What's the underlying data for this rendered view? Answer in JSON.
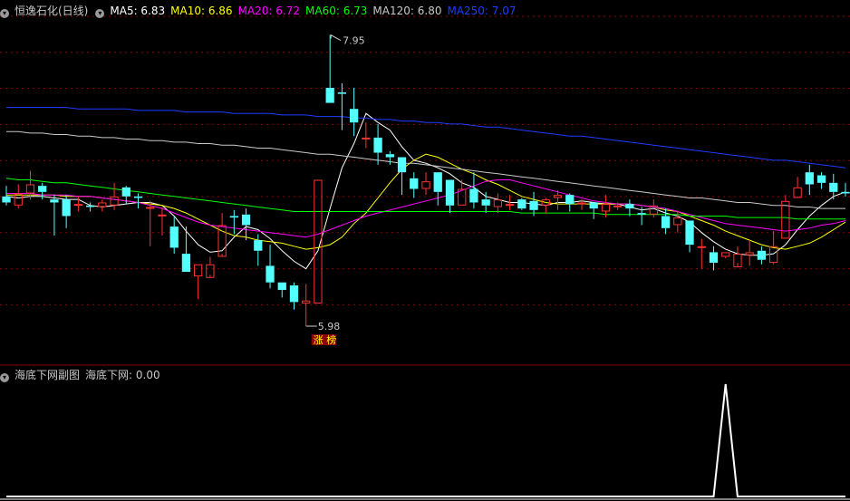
{
  "main_header": {
    "title": "恒逸石化(日线)",
    "indicators": [
      {
        "label": "MA5: 6.83",
        "color": "#ffffff"
      },
      {
        "label": "MA10: 6.86",
        "color": "#ffff00"
      },
      {
        "label": "MA20: 6.72",
        "color": "#ff00ff"
      },
      {
        "label": "MA60: 6.73",
        "color": "#00ff00"
      },
      {
        "label": "MA120: 6.80",
        "color": "#c8c8c8"
      },
      {
        "label": "MA250: 7.07",
        "color": "#1e3cff"
      }
    ]
  },
  "sub_header": {
    "title": "海底下网副图",
    "value_label": "海底下网: 0.00"
  },
  "annotations": {
    "high_label": "7.95",
    "low_label": "5.98",
    "badge": "涨 榜"
  },
  "colors": {
    "up": "#ff3232",
    "down": "#54ffff",
    "grid": "#8b0000",
    "divider": "#8b0000"
  },
  "icons": {
    "collapse": "chevron-down-icon"
  },
  "chart_data": {
    "type": "candlestick",
    "ylim": [
      5.9,
      8.05
    ],
    "candles": [
      [
        6.88,
        6.84,
        6.95,
        6.82
      ],
      [
        6.82,
        6.9,
        6.96,
        6.8
      ],
      [
        6.9,
        6.96,
        7.05,
        6.86
      ],
      [
        6.95,
        6.91,
        6.97,
        6.86
      ],
      [
        6.86,
        6.84,
        6.89,
        6.62
      ],
      [
        6.86,
        6.75,
        6.89,
        6.67
      ],
      [
        6.82,
        6.83,
        6.88,
        6.78
      ],
      [
        6.82,
        6.81,
        6.84,
        6.78
      ],
      [
        6.81,
        6.84,
        6.86,
        6.78
      ],
      [
        6.82,
        6.88,
        6.97,
        6.79
      ],
      [
        6.94,
        6.88,
        6.95,
        6.83
      ],
      [
        6.88,
        6.87,
        6.9,
        6.8
      ],
      [
        6.81,
        6.81,
        6.85,
        6.55
      ],
      [
        6.76,
        6.76,
        6.81,
        6.62
      ],
      [
        6.68,
        6.54,
        6.75,
        6.5
      ],
      [
        6.5,
        6.38,
        6.68,
        6.38
      ],
      [
        6.35,
        6.43,
        6.43,
        6.2
      ],
      [
        6.34,
        6.43,
        6.48,
        6.36
      ],
      [
        6.48,
        6.69,
        6.77,
        6.5
      ],
      [
        6.75,
        6.74,
        6.79,
        6.63
      ],
      [
        6.76,
        6.69,
        6.8,
        6.59
      ],
      [
        6.59,
        6.52,
        6.63,
        6.42
      ],
      [
        6.42,
        6.31,
        6.56,
        6.27
      ],
      [
        6.31,
        6.26,
        6.31,
        6.21
      ],
      [
        6.29,
        6.18,
        6.31,
        6.13
      ],
      [
        6.17,
        6.19,
        6.3,
        6.02
      ],
      [
        6.17,
        6.99,
        6.99,
        6.17
      ],
      [
        7.6,
        7.5,
        7.95,
        7.5
      ],
      [
        7.57,
        7.56,
        7.63,
        7.32
      ],
      [
        7.46,
        7.37,
        7.6,
        7.28
      ],
      [
        7.26,
        7.27,
        7.37,
        7.2
      ],
      [
        7.27,
        7.17,
        7.36,
        7.09
      ],
      [
        7.16,
        7.14,
        7.18,
        7.09
      ],
      [
        7.14,
        7.04,
        7.14,
        6.89
      ],
      [
        7.0,
        6.93,
        7.04,
        6.87
      ],
      [
        6.93,
        6.98,
        7.04,
        6.89
      ],
      [
        7.04,
        6.91,
        7.04,
        6.82
      ],
      [
        6.99,
        6.82,
        6.99,
        6.77
      ],
      [
        6.82,
        6.93,
        6.99,
        6.82
      ],
      [
        6.93,
        6.84,
        7.04,
        6.8
      ],
      [
        6.86,
        6.82,
        6.91,
        6.77
      ],
      [
        6.81,
        6.86,
        6.9,
        6.77
      ],
      [
        6.83,
        6.83,
        6.89,
        6.79
      ],
      [
        6.86,
        6.8,
        6.87,
        6.79
      ],
      [
        6.85,
        6.79,
        6.91,
        6.75
      ],
      [
        6.82,
        6.86,
        6.87,
        6.77
      ],
      [
        6.87,
        6.89,
        6.92,
        6.79
      ],
      [
        6.89,
        6.83,
        6.9,
        6.78
      ],
      [
        6.84,
        6.84,
        6.86,
        6.79
      ],
      [
        6.84,
        6.8,
        6.84,
        6.73
      ],
      [
        6.78,
        6.83,
        6.89,
        6.74
      ],
      [
        6.81,
        6.82,
        6.84,
        6.79
      ],
      [
        6.83,
        6.8,
        6.86,
        6.75
      ],
      [
        6.77,
        6.76,
        6.81,
        6.69
      ],
      [
        6.76,
        6.82,
        6.86,
        6.74
      ],
      [
        6.75,
        6.67,
        6.8,
        6.63
      ],
      [
        6.69,
        6.74,
        6.78,
        6.64
      ],
      [
        6.72,
        6.56,
        6.72,
        6.51
      ],
      [
        6.54,
        6.55,
        6.6,
        6.4
      ],
      [
        6.51,
        6.44,
        6.55,
        6.39
      ],
      [
        6.48,
        6.51,
        6.51,
        6.47
      ],
      [
        6.41,
        6.5,
        6.55,
        6.44
      ],
      [
        6.49,
        6.51,
        6.59,
        6.42
      ],
      [
        6.52,
        6.46,
        6.55,
        6.43
      ],
      [
        6.44,
        6.55,
        6.65,
        6.43
      ],
      [
        6.6,
        6.85,
        6.89,
        6.6
      ],
      [
        6.87,
        6.94,
        7.01,
        6.88
      ],
      [
        7.04,
        6.96,
        7.09,
        6.89
      ],
      [
        7.02,
        6.97,
        7.04,
        6.93
      ],
      [
        6.97,
        6.91,
        7.03,
        6.86
      ],
      [
        6.91,
        6.9,
        6.97,
        6.88
      ]
    ],
    "series": [
      {
        "name": "MA5",
        "color": "#ffffff",
        "values": [
          6.88,
          6.87,
          6.88,
          6.88,
          6.87,
          6.86,
          6.86,
          6.82,
          6.81,
          6.82,
          6.83,
          6.84,
          6.84,
          6.82,
          6.75,
          6.65,
          6.56,
          6.51,
          6.52,
          6.61,
          6.68,
          6.66,
          6.6,
          6.52,
          6.45,
          6.4,
          6.52,
          6.8,
          7.07,
          7.23,
          7.43,
          7.37,
          7.32,
          7.21,
          7.12,
          7.1,
          7.07,
          7.03,
          6.97,
          6.94,
          6.88,
          6.86,
          6.84,
          6.84,
          6.83,
          6.82,
          6.84,
          6.84,
          6.85,
          6.84,
          6.83,
          6.83,
          6.81,
          6.79,
          6.8,
          6.77,
          6.75,
          6.71,
          6.64,
          6.58,
          6.53,
          6.5,
          6.49,
          6.49,
          6.5,
          6.56,
          6.66,
          6.75,
          6.82,
          6.88,
          6.91
        ]
      },
      {
        "name": "MA10",
        "color": "#ffff00",
        "values": [
          6.89,
          6.89,
          6.89,
          6.89,
          6.89,
          6.88,
          6.88,
          6.88,
          6.87,
          6.86,
          6.85,
          6.84,
          6.83,
          6.82,
          6.8,
          6.77,
          6.73,
          6.69,
          6.65,
          6.62,
          6.61,
          6.59,
          6.58,
          6.57,
          6.55,
          6.53,
          6.54,
          6.56,
          6.61,
          6.7,
          6.77,
          6.87,
          6.97,
          7.06,
          7.12,
          7.16,
          7.14,
          7.1,
          7.06,
          7.03,
          6.99,
          6.96,
          6.92,
          6.88,
          6.86,
          6.84,
          6.83,
          6.83,
          6.83,
          6.83,
          6.83,
          6.83,
          6.83,
          6.82,
          6.81,
          6.79,
          6.78,
          6.75,
          6.72,
          6.69,
          6.65,
          6.62,
          6.59,
          6.56,
          6.54,
          6.53,
          6.55,
          6.57,
          6.61,
          6.66,
          6.71
        ]
      },
      {
        "name": "MA20",
        "color": "#ff00ff",
        "values": [
          6.9,
          6.9,
          6.9,
          6.89,
          6.89,
          6.89,
          6.88,
          6.88,
          6.87,
          6.86,
          6.85,
          6.84,
          6.82,
          6.8,
          6.77,
          6.74,
          6.71,
          6.69,
          6.68,
          6.67,
          6.66,
          6.65,
          6.64,
          6.63,
          6.62,
          6.61,
          6.63,
          6.66,
          6.69,
          6.72,
          6.75,
          6.77,
          6.79,
          6.81,
          6.83,
          6.85,
          6.87,
          6.89,
          6.92,
          6.95,
          6.98,
          6.99,
          6.99,
          6.97,
          6.95,
          6.93,
          6.91,
          6.89,
          6.87,
          6.85,
          6.84,
          6.83,
          6.83,
          6.82,
          6.81,
          6.8,
          6.78,
          6.76,
          6.74,
          6.72,
          6.7,
          6.69,
          6.68,
          6.67,
          6.66,
          6.65,
          6.66,
          6.67,
          6.69,
          6.7,
          6.72
        ]
      },
      {
        "name": "MA60",
        "color": "#00ff00",
        "values": [
          7.0,
          6.99,
          6.99,
          6.98,
          6.97,
          6.97,
          6.96,
          6.95,
          6.94,
          6.93,
          6.92,
          6.91,
          6.9,
          6.89,
          6.88,
          6.87,
          6.86,
          6.85,
          6.84,
          6.83,
          6.82,
          6.81,
          6.8,
          6.79,
          6.78,
          6.78,
          6.78,
          6.78,
          6.78,
          6.78,
          6.78,
          6.78,
          6.78,
          6.78,
          6.78,
          6.78,
          6.78,
          6.78,
          6.78,
          6.78,
          6.78,
          6.78,
          6.78,
          6.77,
          6.77,
          6.77,
          6.77,
          6.77,
          6.77,
          6.77,
          6.76,
          6.76,
          6.76,
          6.76,
          6.76,
          6.76,
          6.76,
          6.75,
          6.75,
          6.75,
          6.75,
          6.74,
          6.74,
          6.74,
          6.74,
          6.74,
          6.73,
          6.73,
          6.73,
          6.73,
          6.73
        ]
      },
      {
        "name": "MA120",
        "color": "#c8c8c8",
        "values": [
          7.31,
          7.31,
          7.3,
          7.3,
          7.29,
          7.29,
          7.28,
          7.28,
          7.27,
          7.27,
          7.26,
          7.26,
          7.25,
          7.25,
          7.24,
          7.24,
          7.23,
          7.23,
          7.22,
          7.22,
          7.21,
          7.2,
          7.2,
          7.19,
          7.18,
          7.17,
          7.16,
          7.16,
          7.15,
          7.14,
          7.13,
          7.12,
          7.11,
          7.1,
          7.1,
          7.09,
          7.08,
          7.07,
          7.06,
          7.05,
          7.04,
          7.03,
          7.02,
          7.01,
          7.0,
          6.99,
          6.98,
          6.97,
          6.96,
          6.95,
          6.94,
          6.93,
          6.92,
          6.91,
          6.9,
          6.89,
          6.88,
          6.87,
          6.87,
          6.86,
          6.85,
          6.84,
          6.84,
          6.83,
          6.82,
          6.82,
          6.81,
          6.81,
          6.8,
          6.8,
          6.8
        ]
      },
      {
        "name": "MA250",
        "color": "#1e3cff",
        "values": [
          7.47,
          7.47,
          7.47,
          7.47,
          7.47,
          7.47,
          7.46,
          7.46,
          7.46,
          7.46,
          7.46,
          7.45,
          7.45,
          7.45,
          7.45,
          7.44,
          7.44,
          7.44,
          7.44,
          7.43,
          7.43,
          7.43,
          7.43,
          7.42,
          7.42,
          7.42,
          7.41,
          7.41,
          7.41,
          7.4,
          7.4,
          7.39,
          7.39,
          7.38,
          7.38,
          7.37,
          7.37,
          7.36,
          7.36,
          7.35,
          7.34,
          7.34,
          7.33,
          7.32,
          7.31,
          7.3,
          7.29,
          7.28,
          7.28,
          7.27,
          7.26,
          7.25,
          7.24,
          7.23,
          7.22,
          7.21,
          7.2,
          7.19,
          7.18,
          7.17,
          7.16,
          7.15,
          7.14,
          7.13,
          7.12,
          7.12,
          7.11,
          7.1,
          7.09,
          7.08,
          7.07
        ]
      }
    ],
    "sub_series": {
      "name": "海底下网",
      "color": "#ffffff",
      "ylim": [
        0,
        1
      ],
      "values": [
        0,
        0,
        0,
        0,
        0,
        0,
        0,
        0,
        0,
        0,
        0,
        0,
        0,
        0,
        0,
        0,
        0,
        0,
        0,
        0,
        0,
        0,
        0,
        0,
        0,
        0,
        0,
        0,
        0,
        0,
        0,
        0,
        0,
        0,
        0,
        0,
        0,
        0,
        0,
        0,
        0,
        0,
        0,
        0,
        0,
        0,
        0,
        0,
        0,
        0,
        0,
        0,
        0,
        0,
        0,
        0,
        0,
        0,
        0,
        0,
        1,
        0,
        0,
        0,
        0,
        0,
        0,
        0,
        0,
        0,
        0
      ]
    },
    "high_index": 27,
    "low_index": 25
  }
}
